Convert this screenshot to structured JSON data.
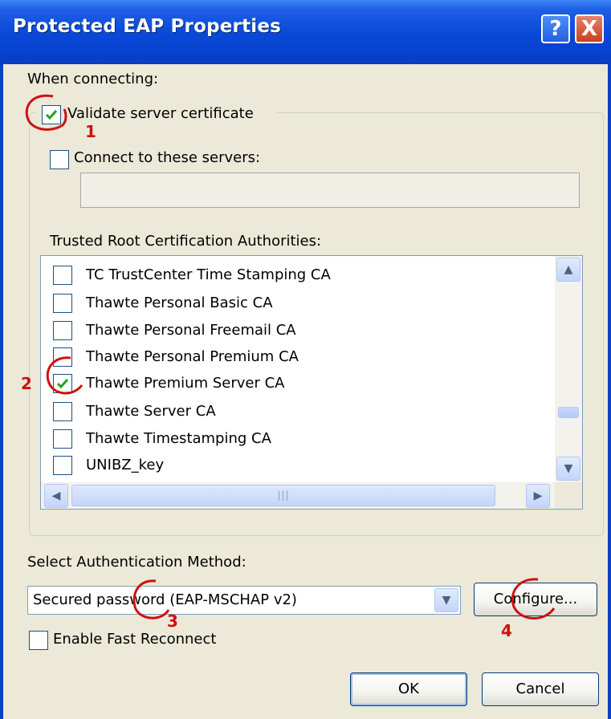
{
  "window": {
    "title": "Protected EAP Properties",
    "help_glyph": "?",
    "close_glyph": "X"
  },
  "when_connecting": {
    "label": "When connecting:",
    "validate_cert": {
      "label": "Validate server certificate",
      "checked": true
    },
    "connect_servers": {
      "label": "Connect to these servers:",
      "checked": false,
      "value": ""
    }
  },
  "trusted_root": {
    "label": "Trusted Root Certification Authorities:",
    "items": [
      {
        "name": "TC TrustCenter Time Stamping CA",
        "checked": false
      },
      {
        "name": "Thawte Personal Basic CA",
        "checked": false
      },
      {
        "name": "Thawte Personal Freemail CA",
        "checked": false
      },
      {
        "name": "Thawte Personal Premium CA",
        "checked": false
      },
      {
        "name": "Thawte Premium Server CA",
        "checked": true
      },
      {
        "name": "Thawte Server CA",
        "checked": false
      },
      {
        "name": "Thawte Timestamping CA",
        "checked": false
      },
      {
        "name": "UNIBZ_key",
        "checked": false
      }
    ]
  },
  "auth": {
    "label": "Select Authentication Method:",
    "selected": "Secured password (EAP-MSCHAP v2)",
    "configure_label": "Configure...",
    "fast_reconnect": {
      "label": "Enable Fast Reconnect",
      "checked": false
    }
  },
  "buttons": {
    "ok": "OK",
    "cancel": "Cancel"
  },
  "annotations": {
    "n1": "1",
    "n2": "2",
    "n3": "3",
    "n4": "4",
    "color": "#d01010"
  },
  "colors": {
    "title_bar": "#0a4ad8",
    "dialog_bg": "#ece9d8",
    "check_green": "#21a121"
  }
}
